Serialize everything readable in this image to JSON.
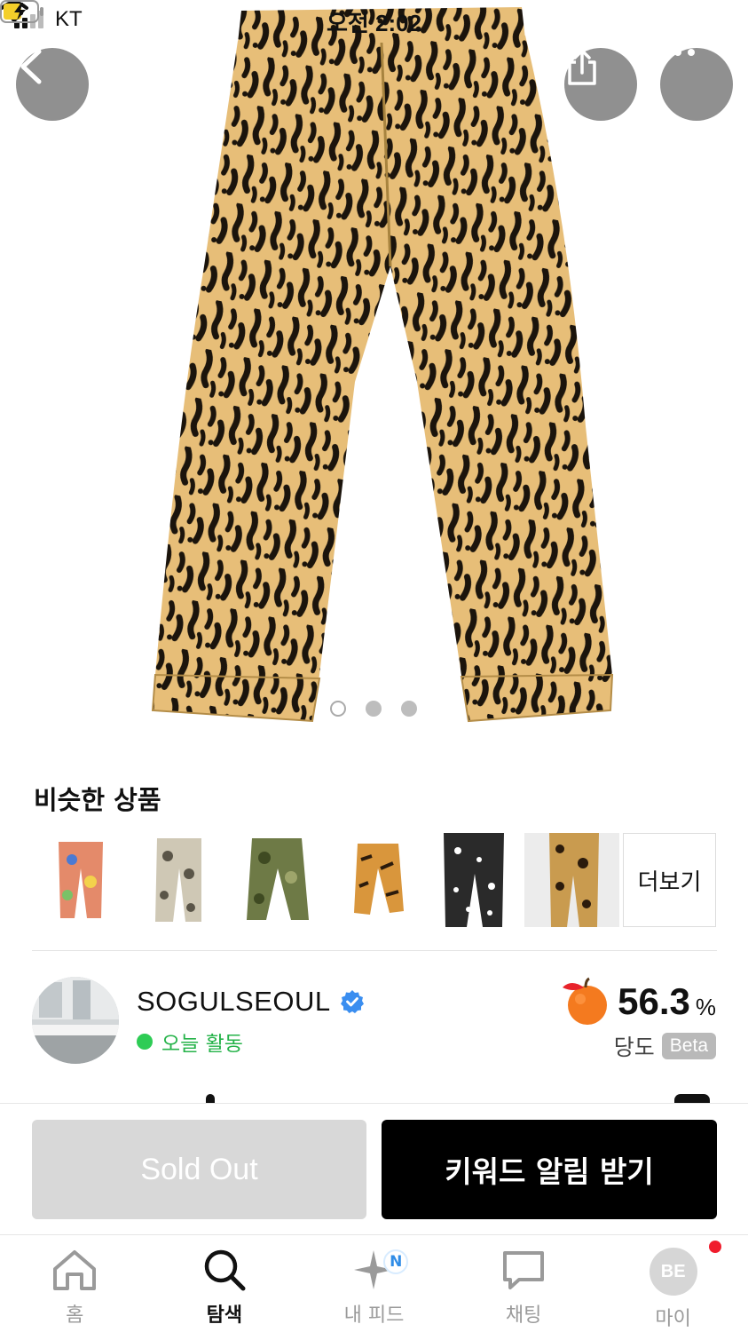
{
  "status_bar": {
    "carrier": "KT",
    "time": "오전 2:02"
  },
  "product_image": {
    "icon": "leopard-pants-photo",
    "page_count": 3,
    "active_page": 1
  },
  "overlay_buttons": {
    "back_icon": "chevron-left-icon",
    "share_icon": "share-icon",
    "more_icon": "more-dots-icon"
  },
  "similar": {
    "title": "비슷한 상품",
    "more_label": "더보기",
    "items": [
      {
        "name": "colorful-print-pants",
        "color": "#e48a6a"
      },
      {
        "name": "camo-print-pants",
        "color": "#bdb6a3"
      },
      {
        "name": "green-camo-pants",
        "color": "#6e7a46"
      },
      {
        "name": "tiger-print-pants",
        "color": "#d9963c"
      },
      {
        "name": "black-white-print-pants",
        "color": "#2a2a2a"
      },
      {
        "name": "leopard-print-pants",
        "color": "#c99b4f"
      }
    ]
  },
  "seller": {
    "name": "SOGULSEOUL",
    "verified_icon": "verified-badge-icon",
    "activity": "오늘 활동",
    "sweetness_value": "56.3",
    "sweetness_unit": "%",
    "sweetness_label": "당도",
    "beta": "Beta"
  },
  "actions": {
    "sold_out": "Sold Out",
    "keyword_alert": "키워드 알림 받기"
  },
  "tabs": [
    {
      "label": "홈",
      "icon": "home-icon"
    },
    {
      "label": "탐색",
      "icon": "search-icon"
    },
    {
      "label": "내 피드",
      "icon": "sparkle-icon",
      "badge": "N"
    },
    {
      "label": "채팅",
      "icon": "chat-icon"
    },
    {
      "label": "마이",
      "icon": "profile-avatar",
      "avatar_text": "BE"
    }
  ],
  "colors": {
    "activity_green": "#26b34a",
    "accent_black": "#000000",
    "sold_out_gray": "#d8d8d8",
    "notification_red": "#f01c2c"
  }
}
